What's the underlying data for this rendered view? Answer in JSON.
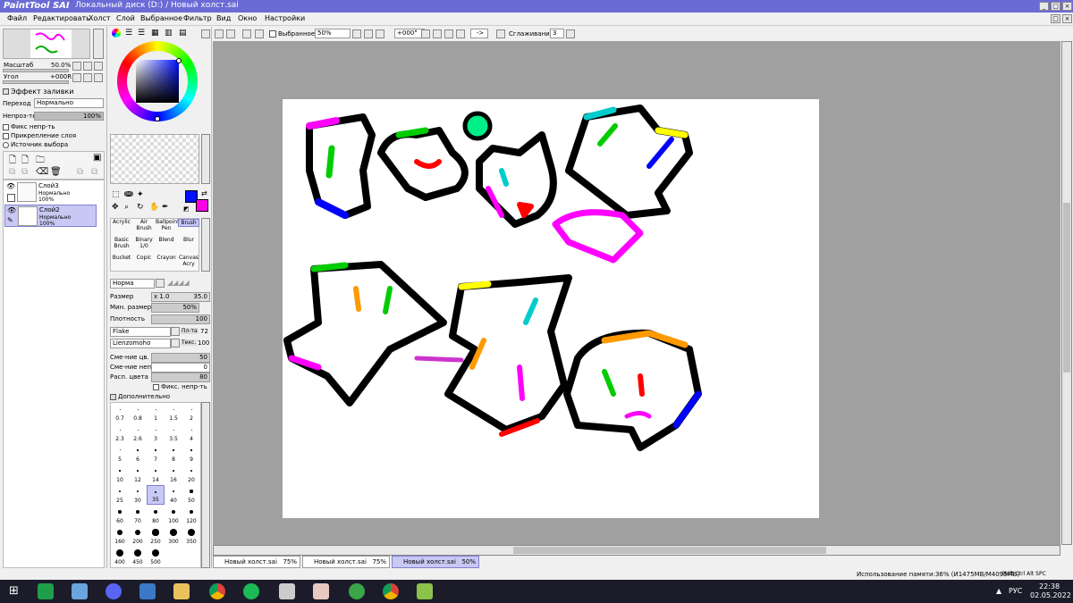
{
  "window": {
    "logo": "PaintTool SAI",
    "title": "Локальный диск (D:) / Новый холст.sai"
  },
  "menu": [
    "Файл",
    "Редактировать",
    "Холст",
    "Слой",
    "Выбранное",
    "Фильтр",
    "Вид",
    "Окно",
    "Настройки"
  ],
  "navigator": {
    "zoom_label": "Масштаб",
    "zoom_value": "50.0%",
    "angle_label": "Угол",
    "angle_value": "+000R"
  },
  "layer_panel": {
    "fill_effect": "Эффект заливки",
    "blend_label": "Переход",
    "blend_value": "Нормально",
    "opacity_label": "Непроз-ть",
    "opacity_value": "100%",
    "opts": [
      "Фикс непр-ть",
      "Прикрепление слоя",
      "Источник выбора"
    ]
  },
  "layers": [
    {
      "name": "Слой3",
      "mode": "Нормально",
      "opacity": "100%"
    },
    {
      "name": "Слой2",
      "mode": "Нормально",
      "opacity": "100%"
    }
  ],
  "toolbar": {
    "selected_label": "Выбранное",
    "zoom": "50%",
    "angle": "+000°",
    "arrow": "->",
    "smooth_label": "Сглаживание",
    "smooth_value": "3"
  },
  "tools": {
    "brushes": [
      "Acrylic",
      "Air Brush",
      "Ballpoint Pen",
      "Brush",
      "Basic Brush",
      "Binary 1/0",
      "Blend",
      "Blur",
      "Bucket",
      "Copic",
      "Crayon",
      "Canvas Acry"
    ],
    "mode": "Норма",
    "size_label": "Размер",
    "size_mult": "x 1.0",
    "size_value": "35.0",
    "min_size_label": "Мин. размер",
    "min_size_value": "50%",
    "density_label": "Плотность",
    "density_value": "100",
    "shape": "Flake",
    "shape_tag": "Пл-та",
    "shape_value": "72",
    "texture": "Lienzomoho",
    "texture_tag": "Текс.",
    "texture_value": "100",
    "mix1_label": "Сме-ние цв.",
    "mix1_value": "50",
    "mix2_label": "Сме-ние непр.",
    "mix2_value": "0",
    "mix3_label": "Расп. цвета",
    "mix3_value": "80",
    "fix_opacity": "Фикс. непр-ть",
    "advanced": "Дополнительно"
  },
  "brush_sizes": [
    "0.7",
    "0.8",
    "1",
    "1.5",
    "2",
    "2.3",
    "2.6",
    "3",
    "3.5",
    "4",
    "5",
    "6",
    "7",
    "8",
    "9",
    "10",
    "12",
    "14",
    "16",
    "20",
    "25",
    "30",
    "35",
    "40",
    "50",
    "60",
    "70",
    "80",
    "100",
    "120",
    "160",
    "200",
    "250",
    "300",
    "350",
    "400",
    "450",
    "500"
  ],
  "tabs": [
    {
      "name": "Новый холст.sai",
      "zoom": "75%"
    },
    {
      "name": "Новый холст.sai",
      "zoom": "75%"
    },
    {
      "name": "Новый холст.sai",
      "zoom": "50%"
    }
  ],
  "status": {
    "memory": "Использование памяти:36% (И1475MB/М4095MB)",
    "keys": "Shift Ctrl Alt SPC"
  },
  "taskbar": {
    "lang": "РУС",
    "time": "22:38",
    "date": "02.05.2022"
  },
  "colors": {
    "fg": "#0010ff",
    "bg": "#ff00e6"
  }
}
